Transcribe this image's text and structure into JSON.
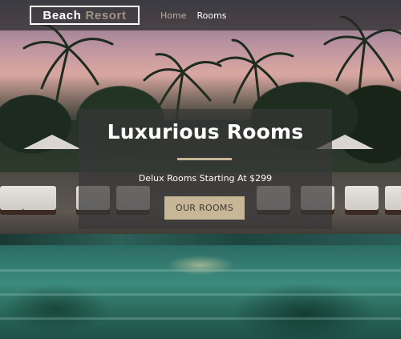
{
  "nav": {
    "logo_word1": "Beach",
    "logo_word2": "Resort",
    "links": [
      {
        "label": "Home"
      },
      {
        "label": "Rooms"
      }
    ]
  },
  "hero": {
    "title": "Luxurious Rooms",
    "subtitle": "Delux Rooms Starting At $299",
    "cta_label": "OUR ROOMS"
  },
  "colors": {
    "accent": "#c8b796",
    "nav_background": "#282828",
    "logo_secondary": "#9f9383",
    "card_background": "#373737"
  }
}
